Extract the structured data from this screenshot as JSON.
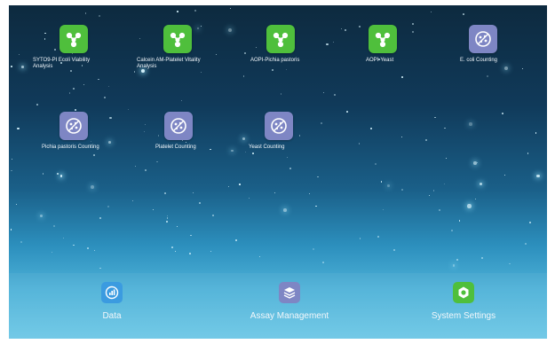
{
  "apps": [
    {
      "label": "SYTO9-PI Ecoli Viability Analysis",
      "line1": "SYTO9-PI Ecoli Viability",
      "line2": "Analysis",
      "icon": "molecule-icon",
      "color": "#4fbf3c"
    },
    {
      "label": "Calcein AM-Platelet Vitality Analysis",
      "line1": "Calcein AM-Platelet Vitality",
      "line2": "Analysis",
      "icon": "molecule-icon",
      "color": "#4fbf3c"
    },
    {
      "label": "AOPI-Pichia pastoris",
      "line1": "AOPI-Pichia pastoris",
      "line2": "",
      "icon": "molecule-icon",
      "color": "#4fbf3c"
    },
    {
      "label": "AOPI-Yeast",
      "line1": "AOPI-Yeast",
      "line2": "",
      "icon": "molecule-icon",
      "color": "#4fbf3c"
    },
    {
      "label": "E. coli Counting",
      "line1": "E. coli Counting",
      "line2": "",
      "icon": "cell-counting-icon",
      "color": "#7e86c4"
    },
    {
      "label": "Pichia pastoris Counting",
      "line1": "Pichia pastoris Counting",
      "line2": "",
      "icon": "cell-counting-icon",
      "color": "#7e86c4"
    },
    {
      "label": "Platelet Counting",
      "line1": "Platelet Counting",
      "line2": "",
      "icon": "cell-counting-icon",
      "color": "#7e86c4"
    },
    {
      "label": "Yeast Counting",
      "line1": "Yeast Counting",
      "line2": "",
      "icon": "cell-counting-icon",
      "color": "#7e86c4"
    }
  ],
  "dock": [
    {
      "label": "Data",
      "icon": "chart-icon",
      "color": "#3b9be0"
    },
    {
      "label": "Assay Management",
      "icon": "layers-icon",
      "color": "#7e86c4"
    },
    {
      "label": "System Settings",
      "icon": "hexagon-settings-icon",
      "color": "#4fbf3c"
    }
  ]
}
